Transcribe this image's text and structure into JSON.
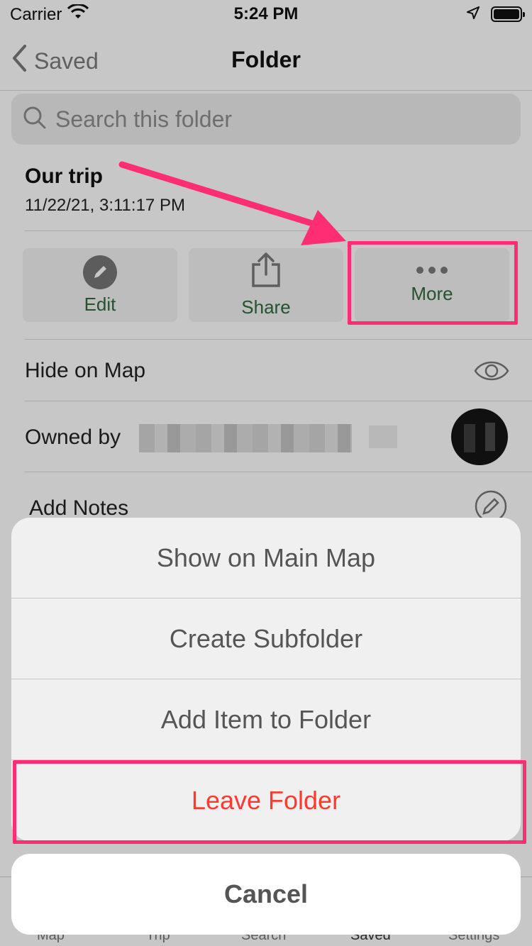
{
  "status_bar": {
    "carrier": "Carrier",
    "time": "5:24 PM"
  },
  "nav": {
    "back_label": "Saved",
    "title": "Folder"
  },
  "search": {
    "placeholder": "Search this folder"
  },
  "folder": {
    "name": "Our trip",
    "date": "11/22/21, 3:11:17 PM"
  },
  "actions": {
    "edit_label": "Edit",
    "share_label": "Share",
    "more_label": "More"
  },
  "rows": {
    "hide_on_map": "Hide on Map",
    "owned_by": "Owned by",
    "add_notes": "Add Notes"
  },
  "action_sheet": {
    "items": [
      "Show on Main Map",
      "Create Subfolder",
      "Add Item to Folder",
      "Leave Folder"
    ],
    "cancel_label": "Cancel"
  },
  "tab_bar": {
    "tabs": [
      "Map",
      "Trip",
      "Search",
      "Saved",
      "Settings"
    ]
  },
  "colors": {
    "accent_green": "#2f6b3a",
    "destructive_red": "#ff3b30",
    "highlight_pink": "#ff2e74"
  }
}
